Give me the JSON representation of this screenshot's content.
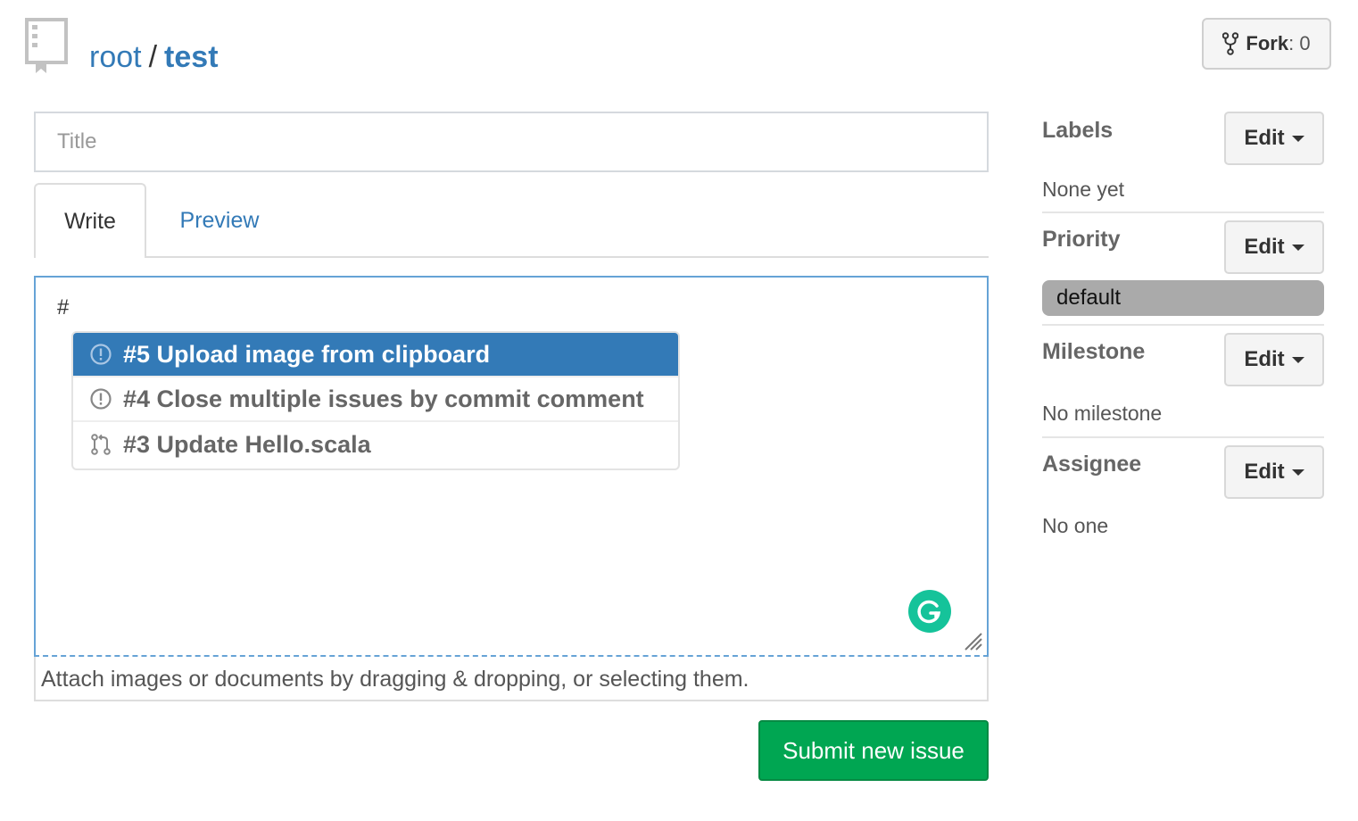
{
  "repo": {
    "owner": "root",
    "separator": "/",
    "name": "test"
  },
  "fork": {
    "label": "Fork",
    "colon": ":",
    "count": "0"
  },
  "form": {
    "title_placeholder": "Title",
    "tabs": {
      "write": "Write",
      "preview": "Preview"
    },
    "editor_value": "#",
    "attach_hint": "Attach images or documents by dragging & dropping, or selecting them.",
    "submit_label": "Submit new issue"
  },
  "suggestions": [
    {
      "text": "#5 Upload image from clipboard",
      "icon": "issue-icon",
      "selected": true
    },
    {
      "text": "#4 Close multiple issues by commit comment",
      "icon": "issue-icon",
      "selected": false
    },
    {
      "text": "#3 Update Hello.scala",
      "icon": "pull-request-icon",
      "selected": false
    }
  ],
  "sidebar": {
    "labels": {
      "heading": "Labels",
      "edit": "Edit",
      "value": "None yet"
    },
    "priority": {
      "heading": "Priority",
      "edit": "Edit",
      "value": "default"
    },
    "milestone": {
      "heading": "Milestone",
      "edit": "Edit",
      "value": "No milestone"
    },
    "assignee": {
      "heading": "Assignee",
      "edit": "Edit",
      "value": "No one"
    }
  },
  "colors": {
    "link": "#337ab7",
    "submit": "#00a652",
    "selected_suggestion": "#337ab7",
    "grammarly": "#15c39a",
    "priority_badge": "#aaaaaa"
  }
}
